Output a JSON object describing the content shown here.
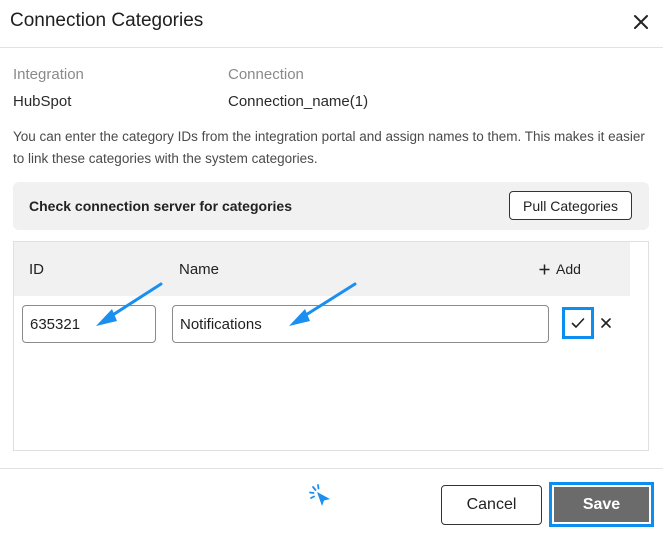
{
  "dialog": {
    "title": "Connection Categories"
  },
  "meta": {
    "integration_label": "Integration",
    "integration_value": "HubSpot",
    "connection_label": "Connection",
    "connection_value": "Connection_name(1)"
  },
  "description": "You can enter the category IDs from the integration portal and assign names to them. This makes it easier to link these categories with the system categories.",
  "server": {
    "text": "Check connection server for categories",
    "pull_label": "Pull Categories"
  },
  "table": {
    "col_id": "ID",
    "col_name": "Name",
    "add_label": "Add",
    "row": {
      "id_value": "635321",
      "name_value": "Notifications"
    }
  },
  "footer": {
    "cancel_label": "Cancel",
    "save_label": "Save"
  },
  "colors": {
    "highlight": "#0b8ef0",
    "save_bg": "#6b6b6b",
    "panel_bg": "#f1f1f1"
  },
  "icons": [
    "close-icon",
    "plus-icon",
    "check-icon",
    "x-icon",
    "annotation-arrow-icon",
    "click-cursor-icon"
  ]
}
